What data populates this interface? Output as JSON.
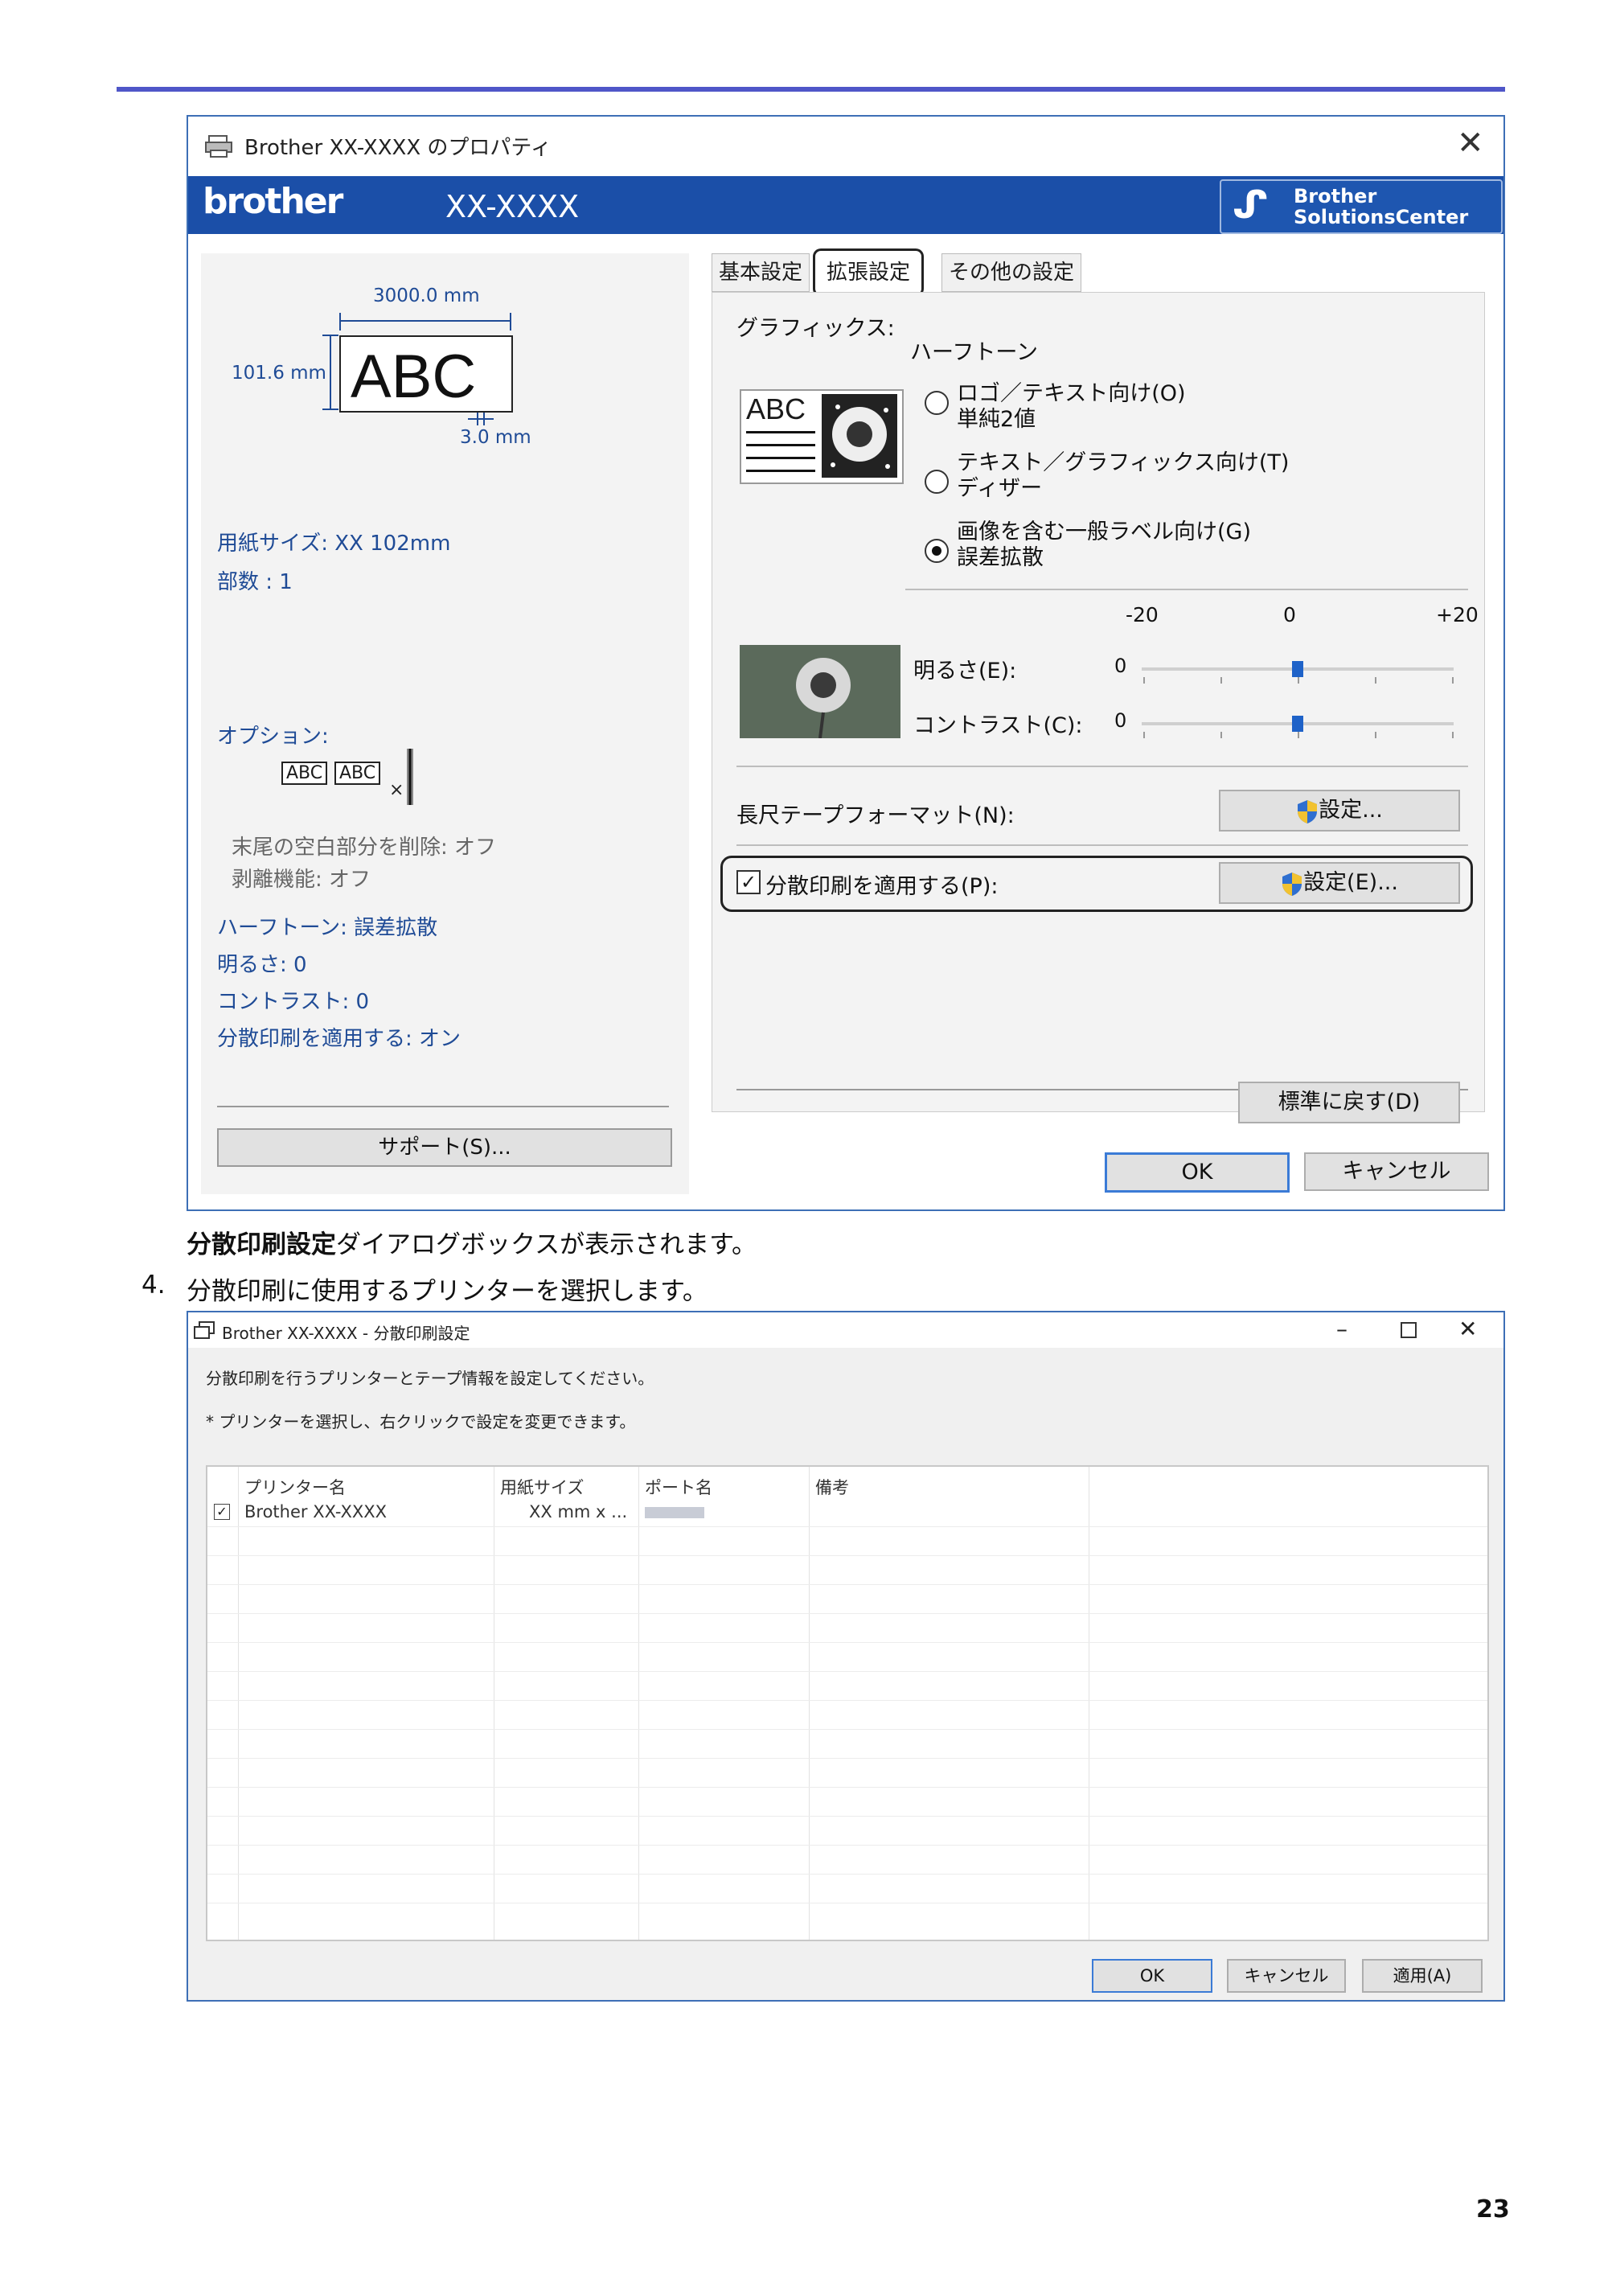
{
  "dialog1": {
    "title": "Brother  XX-XXXX      のプロパティ",
    "model": "XX-XXXX",
    "brand_logo": "brother",
    "solutions_center": [
      "Brother",
      "SolutionsCenter"
    ],
    "preview": {
      "width_label": "3000.0 mm",
      "height_label": "101.6 mm",
      "sample_text": "ABC",
      "margin_label": "3.0 mm"
    },
    "summary": {
      "paper_size": "用紙サイズ: XX 102mm",
      "copies": "部数 : 1",
      "options_label": "オプション:",
      "trim_blank": "末尾の空白部分を削除: オフ",
      "peel": "剥離機能: オフ",
      "halftone": "ハーフトーン: 誤差拡散",
      "brightness": "明るさ:  0",
      "contrast": "コントラスト:  0",
      "distributed": "分散印刷を適用する: オン"
    },
    "option_icon_text": [
      "ABC",
      "ABC"
    ],
    "support_button": "サポート(S)...",
    "tabs": [
      "基本設定",
      "拡張設定",
      "その他の設定"
    ],
    "graphics_label": "グラフィックス:",
    "graphics_icon_text": "ABC",
    "halftone_label": "ハーフトーン",
    "radio_options": [
      {
        "line1": "ロゴ／テキスト向け(O)",
        "line2": "単純2値",
        "selected": false
      },
      {
        "line1": "テキスト／グラフィックス向け(T)",
        "line2": "ディザー",
        "selected": false
      },
      {
        "line1": "画像を含む一般ラベル向け(G)",
        "line2": "誤差拡散",
        "selected": true
      }
    ],
    "scale": {
      "min": "-20",
      "mid": "0",
      "max": "+20"
    },
    "brightness": {
      "label": "明るさ(E):",
      "value": "0",
      "level": 0
    },
    "contrast": {
      "label": "コントラスト(C):",
      "value": "0",
      "level": 0
    },
    "long_tape_label": "長尺テープフォーマット(N):",
    "long_tape_button": "設定...",
    "distributed_label": "分散印刷を適用する(P):",
    "distributed_checked": true,
    "distributed_button": "設定(E)...",
    "defaults_button": "標準に戻す(D)",
    "ok_button": "OK",
    "cancel_button": "キャンセル"
  },
  "caption_bold": "分散印刷設定",
  "caption_rest": "ダイアログボックスが表示されます。",
  "step_number": "4.",
  "step_text": "分散印刷に使用するプリンターを選択します。",
  "dialog2": {
    "title": "Brother  XX-XXXX      - 分散印刷設定",
    "instruction1": "分散印刷を行うプリンターとテープ情報を設定してください。",
    "instruction2": "* プリンターを選択し、右クリックで設定を変更できます。",
    "columns": [
      "プリンター名",
      "用紙サイズ",
      "ポート名",
      "備考"
    ],
    "rows": [
      {
        "checked": true,
        "printer": "Brother XX-XXXX",
        "paper": "XX mm x ...",
        "port": "",
        "note": ""
      }
    ],
    "ok_button": "OK",
    "cancel_button": "キャンセル",
    "apply_button": "適用(A)"
  },
  "page_number": "23",
  "colors": {
    "accent_line": "#4f56c8",
    "banner": "#1b4fa8",
    "summary_text": "#1f4b96"
  }
}
